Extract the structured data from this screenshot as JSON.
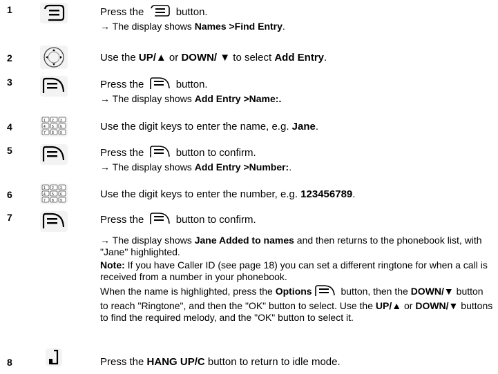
{
  "steps": [
    {
      "num": "1",
      "icon": "menu-button-icon",
      "l1a": "Press the",
      "l1b": "button.",
      "l2a": "→ The display shows ",
      "l2b": "Names >Find Entry",
      "l2c": "."
    },
    {
      "num": "2",
      "icon": "navigation-key-icon",
      "a": "Use the ",
      "b": "UP/",
      "c": "▲",
      "d": " or ",
      "e": "DOWN/",
      "f": " ▼",
      "g": " to select ",
      "h": "Add Entry",
      "i": "."
    },
    {
      "num": "3",
      "icon": "left-softkey-icon",
      "l1a": "Press the",
      "l1b": "button.",
      "l2a": "→ The display shows ",
      "l2b": "Add Entry >Name:.",
      "l2c": ""
    },
    {
      "num": "4",
      "icon": "keypad-icon",
      "a": "Use the digit keys to enter the name, e.g. ",
      "b": "Jane",
      "c": "."
    },
    {
      "num": "5",
      "icon": "left-softkey-icon",
      "l1a": "Press the",
      "l1b": "button to confirm.",
      "l2a": "→ The display shows ",
      "l2b": "Add Entry >Number:",
      "l2c": "."
    },
    {
      "num": "6",
      "icon": "keypad-icon",
      "a": "Use the digit keys to enter the number, e.g. ",
      "b": "123456789",
      "c": "."
    },
    {
      "num": "7",
      "icon": "left-softkey-icon",
      "l1a": "Press the",
      "l1b": "button to confirm.",
      "p1a": "→ The display shows ",
      "p1b": "Jane Added to names",
      "p1c": " and then returns to the phonebook list, with \"Jane\" highlighted.",
      "p2a": "Note:",
      "p2b": " If you have Caller ID (see page 18) you can set a different ringtone for when a call is received from a number in your phonebook.",
      "p3a": "When the name is highlighted, press the ",
      "p3b": "Options",
      "p3c": " button, then the ",
      "p3d": "DOWN/▼",
      "p3e": " button to reach \"Ringtone\", and then the \"OK\" button to select. Use the ",
      "p3f": "UP/▲",
      "p3g": " or ",
      "p3h": "DOWN/▼",
      "p3i": " buttons to find the required melody, and the \"OK\" button to select it."
    },
    {
      "num": "8",
      "icon": "hang-up-handset-icon",
      "a": "Press the ",
      "b": "HANG UP/C",
      "c": " button to return to idle mode."
    }
  ]
}
